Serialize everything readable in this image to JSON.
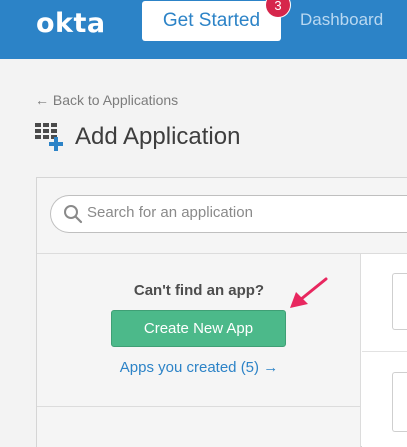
{
  "header": {
    "logo_text": "okta",
    "get_started_label": "Get Started",
    "notification_count": "3",
    "dashboard_label": "Dashboard"
  },
  "page": {
    "back_link": "← Back to Applications",
    "title": "Add Application"
  },
  "search": {
    "placeholder": "Search for an application"
  },
  "sidebar": {
    "cant_find_text": "Can't find an app?",
    "create_button_label": "Create New App",
    "apps_created_link": "Apps you created (5) →"
  },
  "colors": {
    "header_blue": "#2c83c7",
    "badge_red": "#d6264b",
    "create_green": "#4cb98a",
    "annotation_arrow": "#e8275f"
  },
  "icons": {
    "title_icon": "app-grid-plus-icon",
    "search_icon": "magnifier-icon",
    "annotation": "pointer-arrow-icon"
  }
}
